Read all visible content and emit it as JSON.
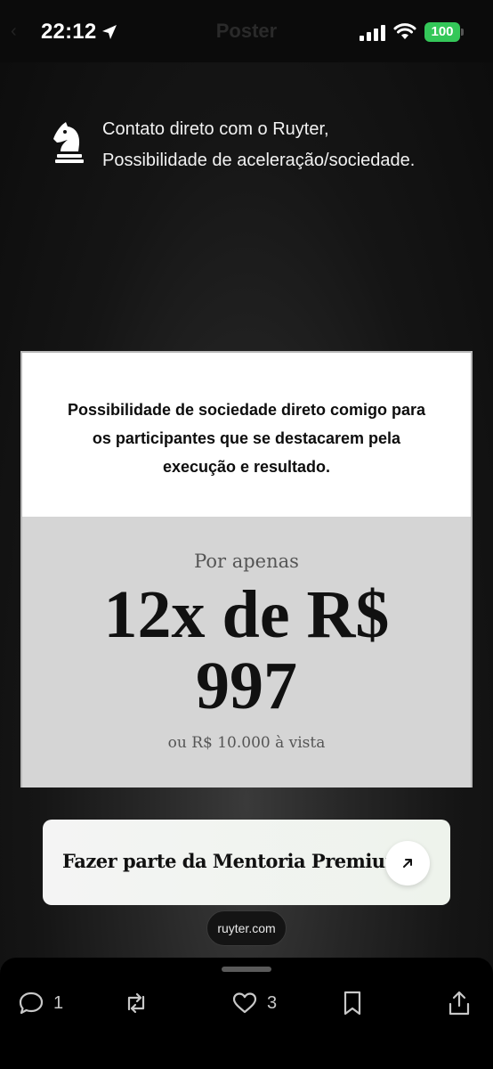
{
  "status_bar": {
    "time": "22:12",
    "battery": "100",
    "title": "Poster"
  },
  "feature": {
    "line1": "Contato direto com o Ruyter,",
    "line2": "Possibilidade de aceleração/sociedade."
  },
  "card": {
    "text": "Possibilidade de sociedade direto comigo para os participantes que se destacarem pela execução e resultado.",
    "price_intro": "Por apenas",
    "price_line1": "12x de R$",
    "price_line2": "997",
    "price_cash": "ou R$ 10.000 à vista"
  },
  "cta": {
    "label": "Fazer parte da Mentoria Premium"
  },
  "domain": "ruyter.com",
  "actions": {
    "replies": "1",
    "likes": "3"
  },
  "colors": {
    "battery": "#34c759",
    "card_bg": "#ffffff",
    "price_panel": "#d5d5d5"
  },
  "icons": [
    "location-arrow-icon",
    "signal-icon",
    "wifi-icon",
    "knight-icon",
    "arrow-up-right-icon",
    "reply-icon",
    "repost-icon",
    "heart-icon",
    "bookmark-icon",
    "share-icon"
  ]
}
